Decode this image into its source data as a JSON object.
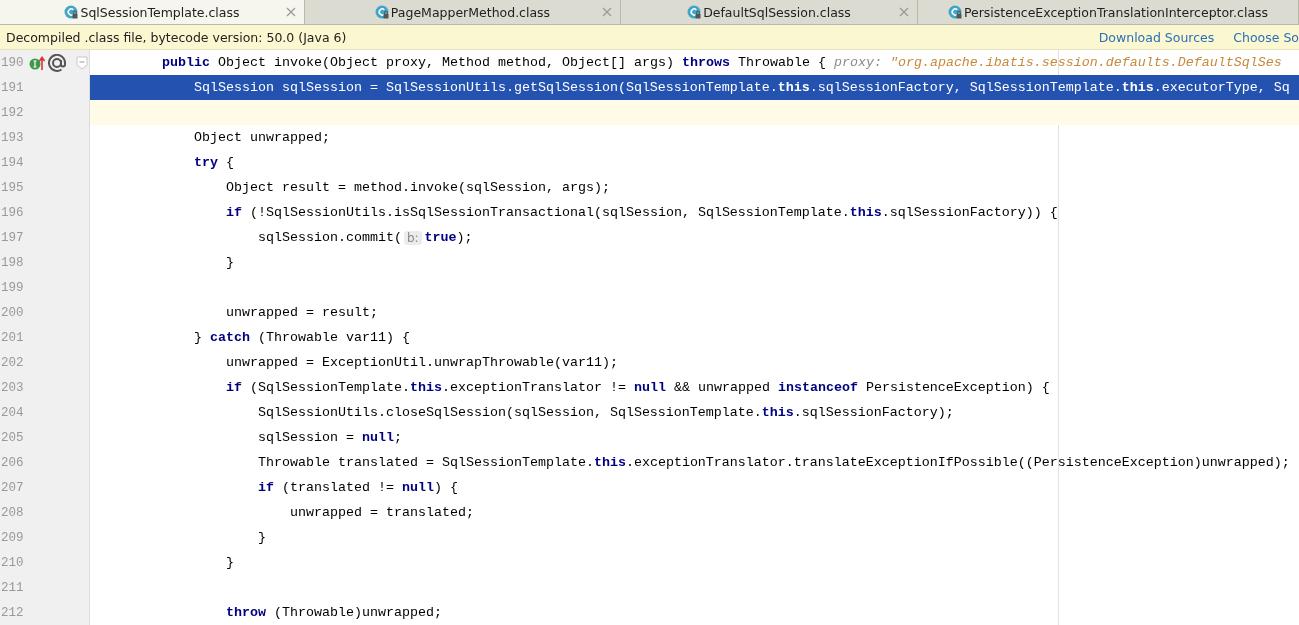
{
  "tabs": [
    {
      "label": "SqlSessionTemplate.class",
      "selected": true,
      "closable": true
    },
    {
      "label": "PageMapperMethod.class",
      "selected": false,
      "closable": true
    },
    {
      "label": "DefaultSqlSession.class",
      "selected": false,
      "closable": true
    },
    {
      "label": "PersistenceExceptionTranslationInterceptor.class",
      "selected": false,
      "closable": false
    }
  ],
  "banner": {
    "text": "Decompiled .class file, bytecode version: 50.0 (Java 6)",
    "links": [
      "Download Sources",
      "Choose So"
    ]
  },
  "lines": [
    {
      "number": "190",
      "selected": false,
      "caret_line": false,
      "foldable": true,
      "gutter_icons": [
        {
          "kind": "implements"
        },
        {
          "kind": "annotation"
        }
      ],
      "segments": [
        {
          "kind": "code",
          "text": "        **public** Object invoke(Object proxy, Method method, Object[] args) **throws** Throwable {"
        },
        {
          "kind": "hint_name",
          "text": "proxy:"
        },
        {
          "kind": "hint_value",
          "text": "\"org.apache.ibatis.session.defaults.DefaultSqlSes"
        }
      ]
    },
    {
      "number": "191",
      "selected": true,
      "caret_line": false,
      "foldable": false,
      "segments": [
        {
          "kind": "code",
          "text": "            SqlSession sqlSession = SqlSessionUtils.getSqlSession(SqlSessionTemplate.**this**.sqlSessionFactory, SqlSessionTemplate.**this**.executorType, Sq"
        }
      ]
    },
    {
      "number": "192",
      "selected": false,
      "caret_line": true,
      "foldable": false
    },
    {
      "number": "193",
      "selected": false,
      "caret_line": false,
      "foldable": false,
      "segments": [
        {
          "kind": "code",
          "text": "            Object unwrapped;"
        }
      ]
    },
    {
      "number": "194",
      "selected": false,
      "caret_line": false,
      "foldable": false,
      "segments": [
        {
          "kind": "code",
          "text": "            **try** {"
        }
      ]
    },
    {
      "number": "195",
      "selected": false,
      "caret_line": false,
      "foldable": false,
      "segments": [
        {
          "kind": "code",
          "text": "                Object result = method.invoke(sqlSession, args);"
        }
      ]
    },
    {
      "number": "196",
      "selected": false,
      "caret_line": false,
      "foldable": false,
      "segments": [
        {
          "kind": "code",
          "text": "                **if** (!SqlSessionUtils.isSqlSessionTransactional(sqlSession, SqlSessionTemplate.**this**.sqlSessionFactory)) {"
        }
      ]
    },
    {
      "number": "197",
      "selected": false,
      "caret_line": false,
      "foldable": false,
      "segments": [
        {
          "kind": "code",
          "text": "                    sqlSession.commit("
        },
        {
          "kind": "param_hint",
          "text": "b:"
        },
        {
          "kind": "code",
          "text": "**true**);"
        }
      ]
    },
    {
      "number": "198",
      "selected": false,
      "caret_line": false,
      "foldable": false,
      "segments": [
        {
          "kind": "code",
          "text": "                }"
        }
      ]
    },
    {
      "number": "199",
      "selected": false,
      "caret_line": false,
      "foldable": false
    },
    {
      "number": "200",
      "selected": false,
      "caret_line": false,
      "foldable": false,
      "segments": [
        {
          "kind": "code",
          "text": "                unwrapped = result;"
        }
      ]
    },
    {
      "number": "201",
      "selected": false,
      "caret_line": false,
      "foldable": false,
      "segments": [
        {
          "kind": "code",
          "text": "            } **catch** (Throwable var11) {"
        }
      ]
    },
    {
      "number": "202",
      "selected": false,
      "caret_line": false,
      "foldable": false,
      "segments": [
        {
          "kind": "code",
          "text": "                unwrapped = ExceptionUtil.unwrapThrowable(var11);"
        }
      ]
    },
    {
      "number": "203",
      "selected": false,
      "caret_line": false,
      "foldable": false,
      "segments": [
        {
          "kind": "code",
          "text": "                **if** (SqlSessionTemplate.**this**.exceptionTranslator != **null** && unwrapped **instanceof** PersistenceException) {"
        }
      ]
    },
    {
      "number": "204",
      "selected": false,
      "caret_line": false,
      "foldable": false,
      "segments": [
        {
          "kind": "code",
          "text": "                    SqlSessionUtils.closeSqlSession(sqlSession, SqlSessionTemplate.**this**.sqlSessionFactory);"
        }
      ]
    },
    {
      "number": "205",
      "selected": false,
      "caret_line": false,
      "foldable": false,
      "segments": [
        {
          "kind": "code",
          "text": "                    sqlSession = **null**;"
        }
      ]
    },
    {
      "number": "206",
      "selected": false,
      "caret_line": false,
      "foldable": false,
      "segments": [
        {
          "kind": "code",
          "text": "                    Throwable translated = SqlSessionTemplate.**this**.exceptionTranslator.translateExceptionIfPossible((PersistenceException)unwrapped);"
        }
      ]
    },
    {
      "number": "207",
      "selected": false,
      "caret_line": false,
      "foldable": false,
      "segments": [
        {
          "kind": "code",
          "text": "                    **if** (translated != **null**) {"
        }
      ]
    },
    {
      "number": "208",
      "selected": false,
      "caret_line": false,
      "foldable": false,
      "segments": [
        {
          "kind": "code",
          "text": "                        unwrapped = translated;"
        }
      ]
    },
    {
      "number": "209",
      "selected": false,
      "caret_line": false,
      "foldable": false,
      "segments": [
        {
          "kind": "code",
          "text": "                    }"
        }
      ]
    },
    {
      "number": "210",
      "selected": false,
      "caret_line": false,
      "foldable": false,
      "segments": [
        {
          "kind": "code",
          "text": "                }"
        }
      ]
    },
    {
      "number": "211",
      "selected": false,
      "caret_line": false,
      "foldable": false
    },
    {
      "number": "212",
      "selected": false,
      "caret_line": false,
      "foldable": false,
      "segments": [
        {
          "kind": "code",
          "text": "                **throw** (Throwable)unwrapped;"
        }
      ]
    }
  ]
}
